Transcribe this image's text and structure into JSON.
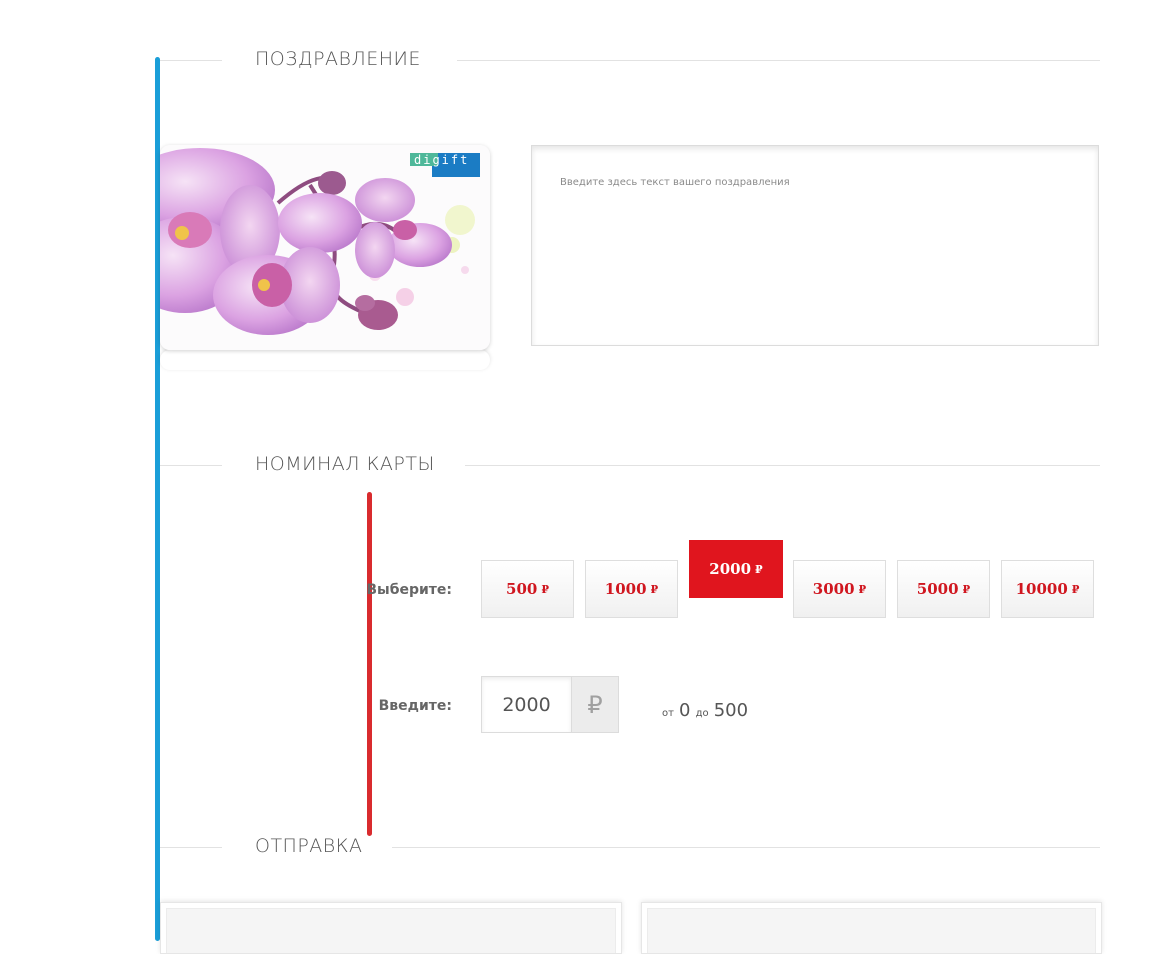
{
  "sections": {
    "greeting": {
      "title": "ПОЗДРАВЛЕНИЕ"
    },
    "nominal": {
      "title": "НОМИНАЛ КАРТЫ"
    },
    "delivery": {
      "title": "ОТПРАВКА"
    }
  },
  "card": {
    "logo_text": "digift"
  },
  "message": {
    "placeholder": "Введите здесь текст вашего поздравления"
  },
  "nominal": {
    "choose_label": "Выберите:",
    "enter_label": "Введите:",
    "currency": "₽",
    "options": [
      {
        "value": "500"
      },
      {
        "value": "1000"
      },
      {
        "value": "2000"
      },
      {
        "value": "3000"
      },
      {
        "value": "5000"
      },
      {
        "value": "10000"
      }
    ],
    "selected": "2000",
    "input_value": "2000",
    "range": {
      "from_word": "от",
      "from_value": "0",
      "to_word": "до",
      "to_value": "500"
    }
  },
  "colors": {
    "accent_blue": "#1a9ed8",
    "accent_red": "#d92b2e",
    "selected_bg": "#e0151e",
    "price_text": "#d0161f"
  }
}
